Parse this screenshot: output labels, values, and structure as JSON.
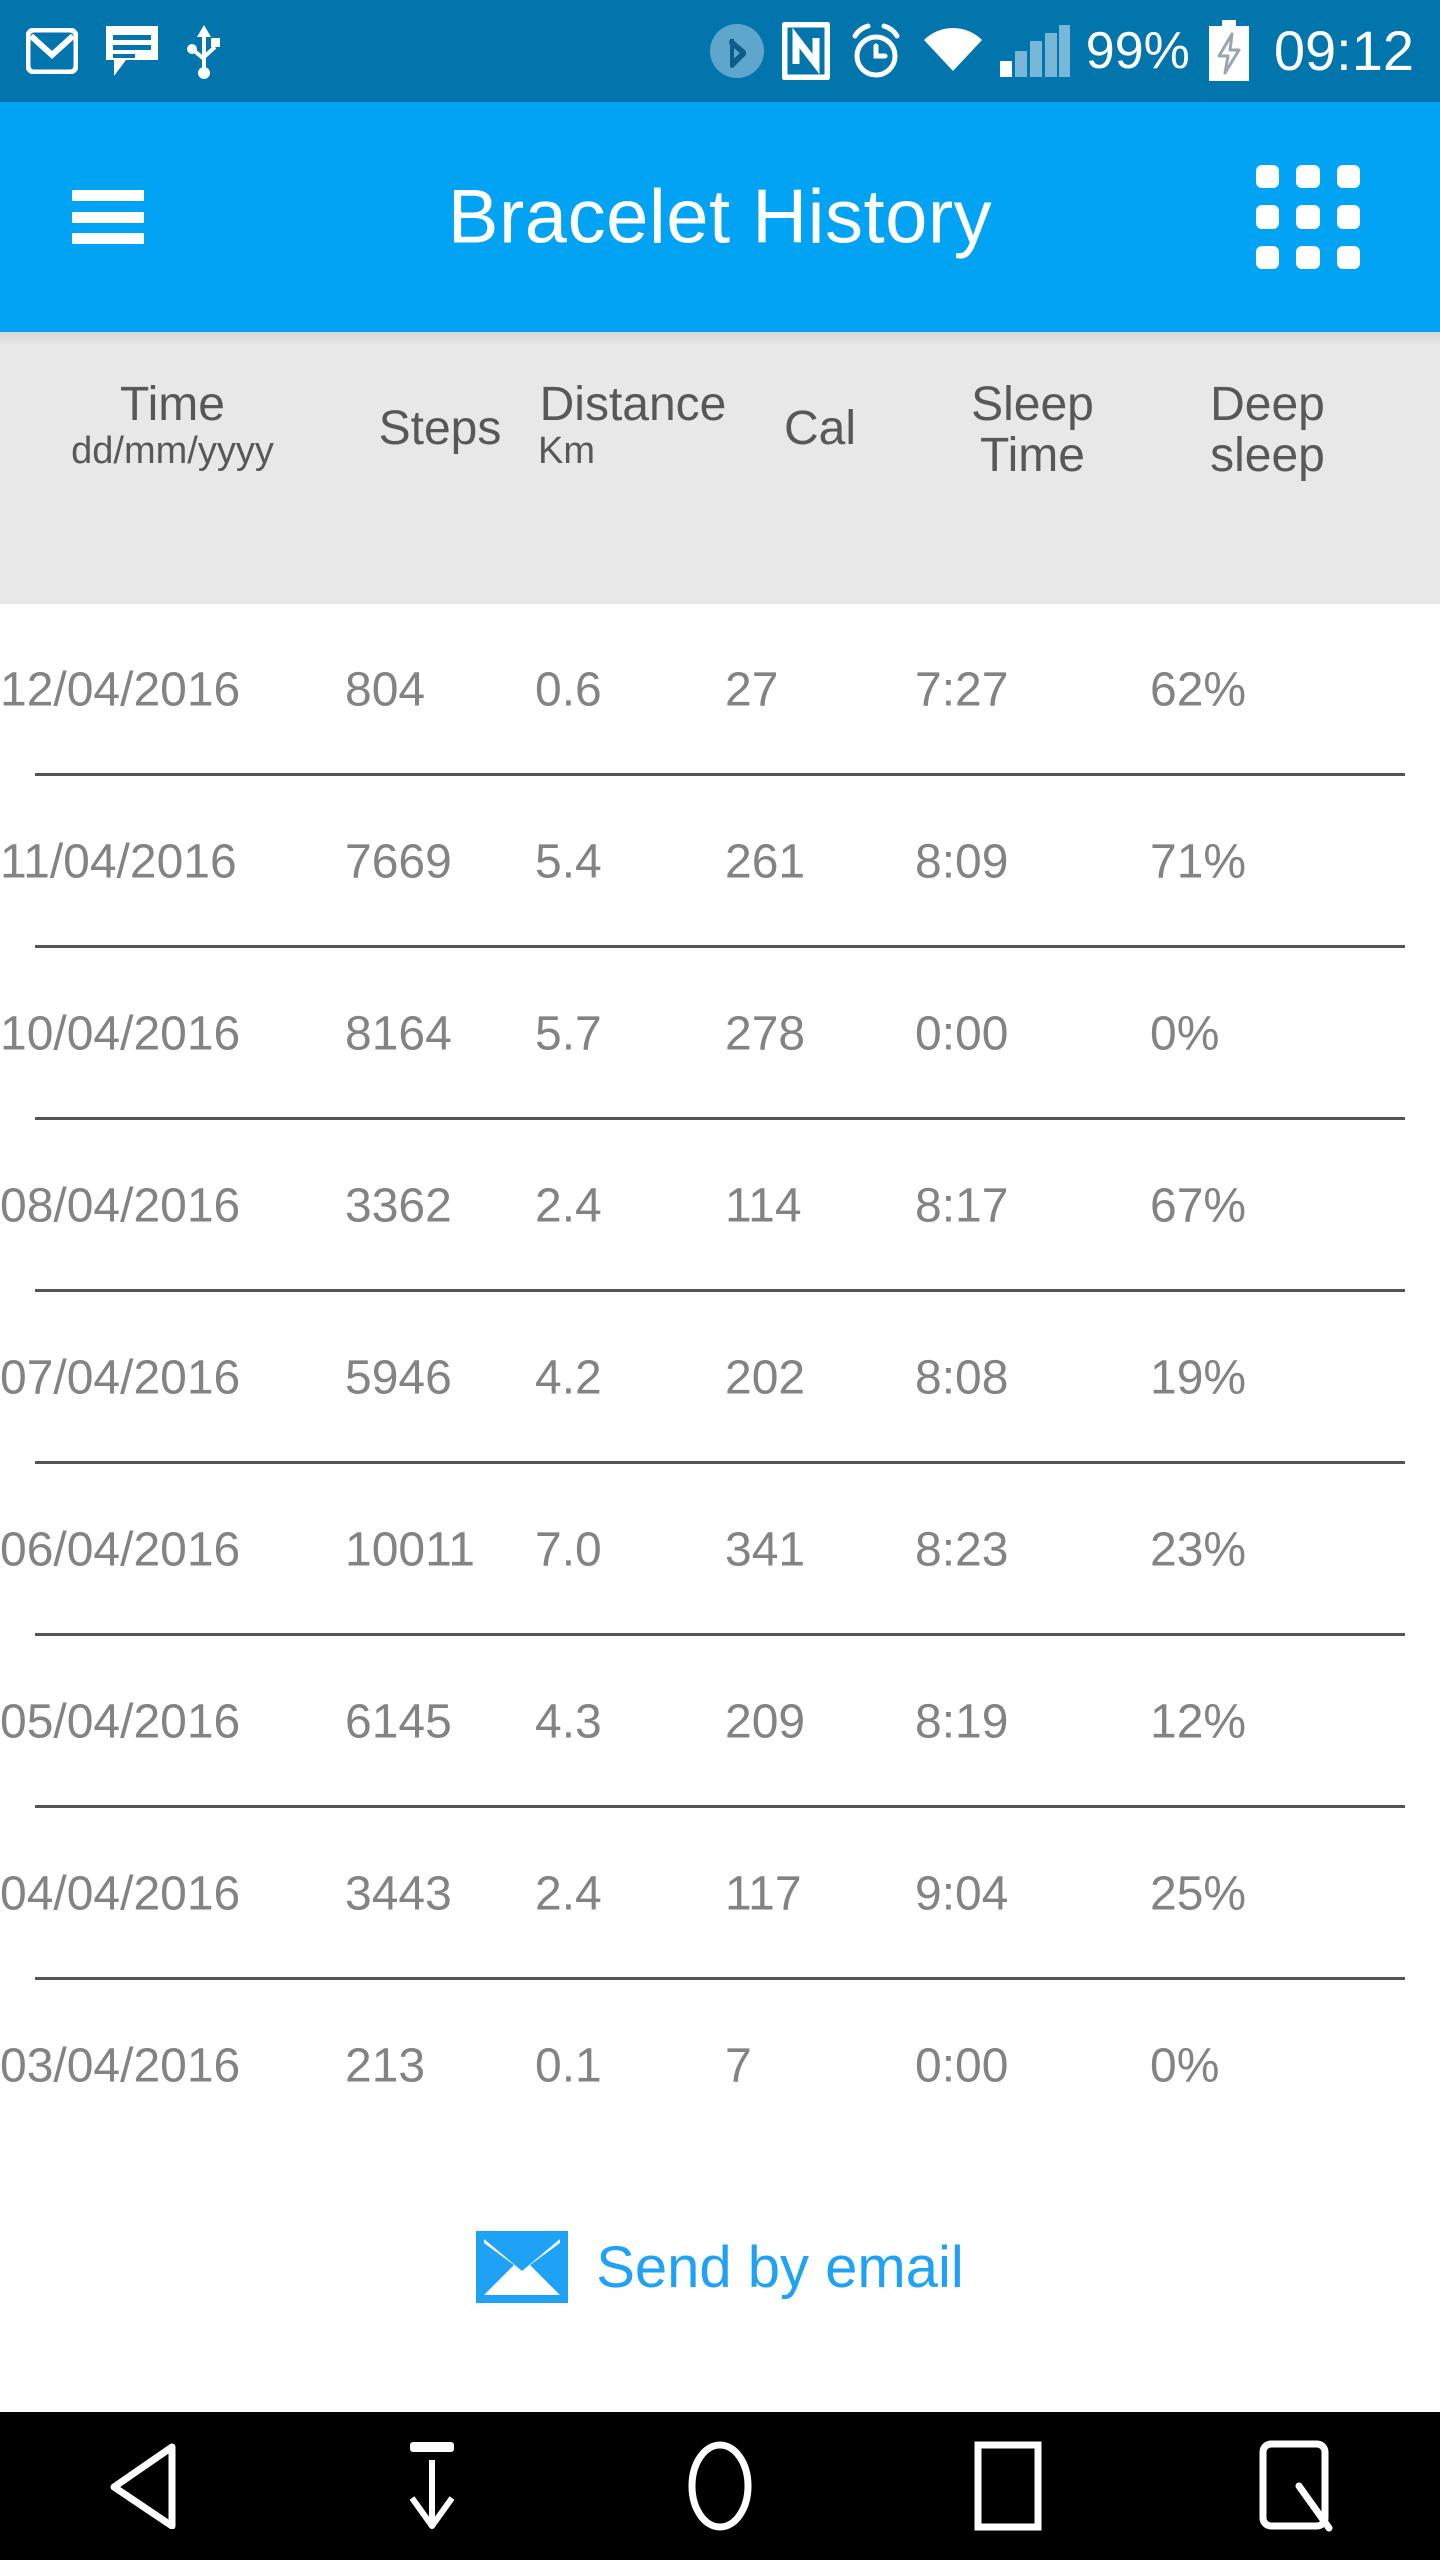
{
  "statusbar": {
    "background": "#0275ad",
    "icons_left": [
      "gmail-icon",
      "messages-icon",
      "usb-icon"
    ],
    "icons_right": [
      "bluetooth-icon",
      "nfc-icon",
      "alarm-icon",
      "wifi-icon",
      "signal-icon"
    ],
    "battery_percent": "99%",
    "battery_state": "charging",
    "clock": "09:12"
  },
  "appbar": {
    "background": "#03a3f4",
    "title": "Bracelet History",
    "menu_icon": "hamburger-icon",
    "grid_icon": "apps-grid-icon"
  },
  "table": {
    "header_background": "#e8e8e8",
    "columns": [
      {
        "label": "Time",
        "sub": "dd/mm/yyyy"
      },
      {
        "label": "Steps",
        "sub": ""
      },
      {
        "label": "Distance",
        "sub": "Km"
      },
      {
        "label": "Cal",
        "sub": ""
      },
      {
        "label": "Sleep",
        "sub": "Time"
      },
      {
        "label": "Deep",
        "sub": "sleep"
      }
    ],
    "rows": [
      {
        "time": "12/04/2016",
        "steps": "804",
        "distance": "0.6",
        "cal": "27",
        "sleep_time": "7:27",
        "deep_sleep": "62%"
      },
      {
        "time": "11/04/2016",
        "steps": "7669",
        "distance": "5.4",
        "cal": "261",
        "sleep_time": "8:09",
        "deep_sleep": "71%"
      },
      {
        "time": "10/04/2016",
        "steps": "8164",
        "distance": "5.7",
        "cal": "278",
        "sleep_time": "0:00",
        "deep_sleep": "0%"
      },
      {
        "time": "08/04/2016",
        "steps": "3362",
        "distance": "2.4",
        "cal": "114",
        "sleep_time": "8:17",
        "deep_sleep": "67%"
      },
      {
        "time": "07/04/2016",
        "steps": "5946",
        "distance": "4.2",
        "cal": "202",
        "sleep_time": "8:08",
        "deep_sleep": "19%"
      },
      {
        "time": "06/04/2016",
        "steps": "10011",
        "distance": "7.0",
        "cal": "341",
        "sleep_time": "8:23",
        "deep_sleep": "23%"
      },
      {
        "time": "05/04/2016",
        "steps": "6145",
        "distance": "4.3",
        "cal": "209",
        "sleep_time": "8:19",
        "deep_sleep": "12%"
      },
      {
        "time": "04/04/2016",
        "steps": "3443",
        "distance": "2.4",
        "cal": "117",
        "sleep_time": "9:04",
        "deep_sleep": "25%"
      },
      {
        "time": "03/04/2016",
        "steps": "213",
        "distance": "0.1",
        "cal": "7",
        "sleep_time": "0:00",
        "deep_sleep": "0%"
      }
    ]
  },
  "send_email": {
    "label": "Send by email",
    "icon": "envelope-icon",
    "color": "#1fa2f5"
  },
  "navbar": {
    "background": "#000000",
    "buttons": [
      "back-icon",
      "hide-keyboard-icon",
      "home-icon",
      "recents-icon",
      "screenshot-icon"
    ]
  }
}
